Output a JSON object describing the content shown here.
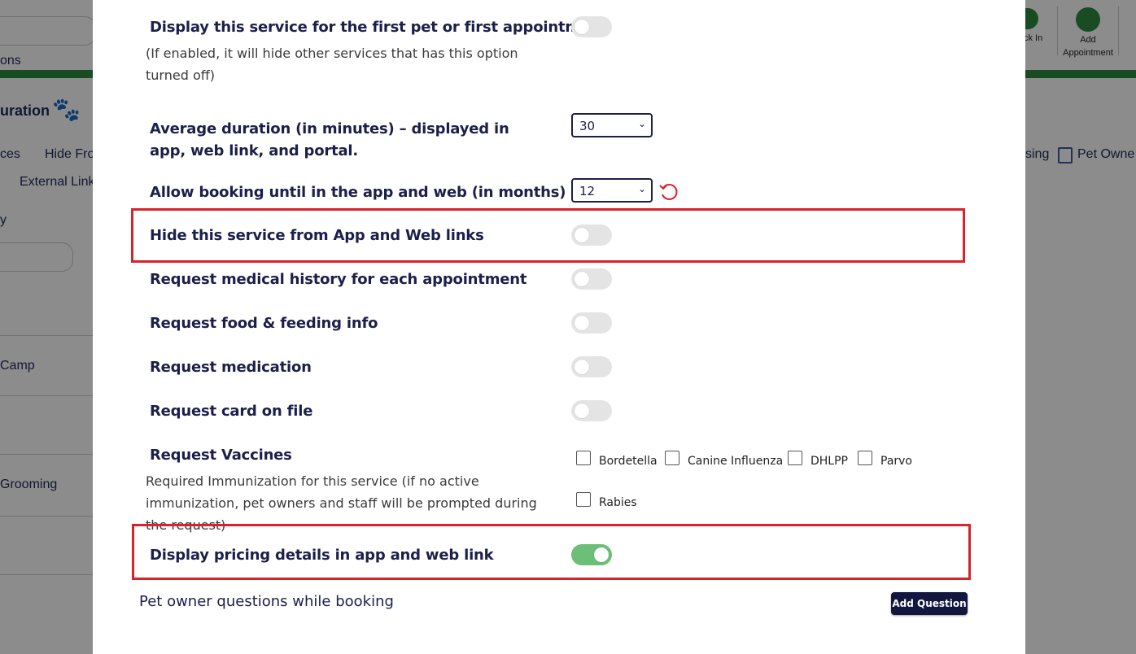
{
  "background": {
    "left_fragments": [
      "ons",
      "uration",
      "ces",
      "Hide Fro",
      "External Link",
      "y",
      "Camp",
      "Grooming"
    ],
    "right_fragments": [
      "ck In",
      "Add Appointment",
      "sing",
      "Pet Owne"
    ]
  },
  "modal": {
    "first_pet": {
      "label": "Display this service for the first pet or first appointment",
      "description": "(If enabled, it will hide other services that has this option turned off)",
      "enabled": false
    },
    "duration": {
      "label": "Average duration (in minutes) – displayed in app, web link, and portal.",
      "value": "30"
    },
    "booking_until": {
      "label": "Allow booking until in the app and web (in months)",
      "value": "12"
    },
    "hide_service": {
      "label": "Hide this service from App and Web links",
      "enabled": false
    },
    "medical_history": {
      "label": "Request medical history for each appointment",
      "enabled": false
    },
    "food_feeding": {
      "label": "Request food & feeding info",
      "enabled": false
    },
    "medication": {
      "label": "Request medication",
      "enabled": false
    },
    "card_on_file": {
      "label": "Request card on file",
      "enabled": false
    },
    "vaccines": {
      "label": "Request Vaccines",
      "description": "Required Immunization for this service (if no active immunization, pet owners and staff will be prompted during the request)",
      "options": [
        "Bordetella",
        "Canine Influenza",
        "DHLPP",
        "Parvo",
        "Rabies"
      ]
    },
    "pricing": {
      "label": "Display pricing details in app and web link",
      "enabled": true
    },
    "questions": {
      "label": "Pet owner questions while booking",
      "button": "Add Question"
    }
  },
  "colors": {
    "accent_navy": "#1c1f4a",
    "highlight_red": "#d8232a",
    "toggle_on": "#6cbf76",
    "toggle_off": "#e4e4e4",
    "brand_green": "#2e8b3e"
  }
}
